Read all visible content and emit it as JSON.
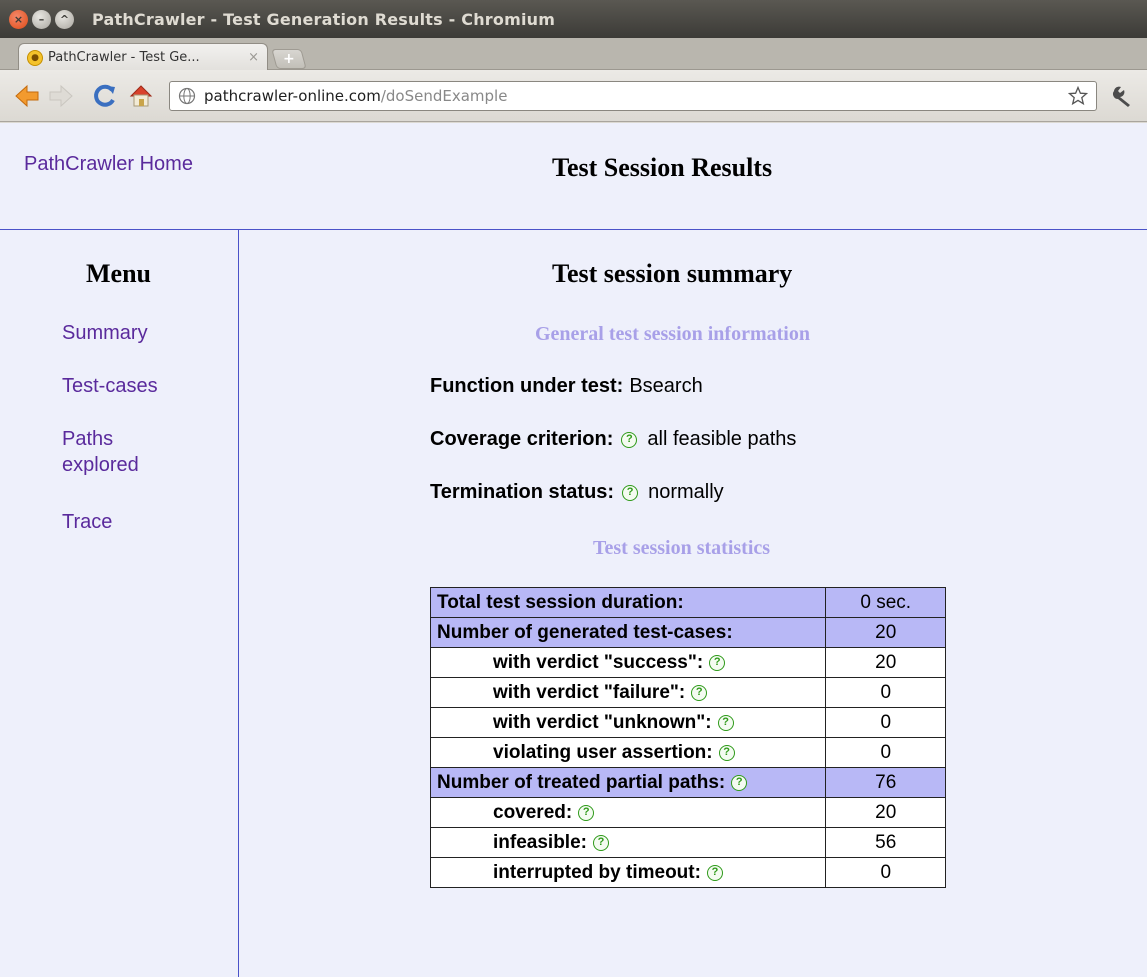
{
  "window": {
    "title": "PathCrawler - Test Generation Results - Chromium"
  },
  "tab": {
    "title": "PathCrawler - Test Ge...",
    "close": "×",
    "new_tab": "+"
  },
  "toolbar": {
    "url_host": "pathcrawler-online.com",
    "url_path": "/doSendExample"
  },
  "header": {
    "home_link": "PathCrawler Home",
    "title": "Test Session Results"
  },
  "menu": {
    "title": "Menu",
    "items": [
      {
        "label": "Summary"
      },
      {
        "label": "Test-cases"
      },
      {
        "label": "Paths explored"
      },
      {
        "label": "Trace"
      }
    ]
  },
  "summary": {
    "title": "Test session summary",
    "general_heading": "General test session information",
    "function_label": "Function under test:",
    "function_value": "Bsearch",
    "coverage_label": "Coverage criterion:",
    "coverage_value": "all feasible paths",
    "termination_label": "Termination status:",
    "termination_value": "normally",
    "stats_heading": "Test session statistics",
    "help_glyph": "?"
  },
  "stats": {
    "rows": [
      {
        "label": "Total test session duration:",
        "value": "0 sec."
      },
      {
        "label": "Number of generated test-cases:",
        "value": "20"
      },
      {
        "label": "with verdict \"success\":",
        "value": "20"
      },
      {
        "label": "with verdict \"failure\":",
        "value": "0"
      },
      {
        "label": "with verdict \"unknown\":",
        "value": "0"
      },
      {
        "label": "violating user assertion:",
        "value": "0"
      },
      {
        "label": "Number of treated partial paths:",
        "value": "76"
      },
      {
        "label": "covered:",
        "value": "20"
      },
      {
        "label": "infeasible:",
        "value": "56"
      },
      {
        "label": "interrupted by timeout:",
        "value": "0"
      }
    ]
  },
  "colors": {
    "link": "#5a2a9c",
    "rule": "#4a52c8",
    "sub_heading": "#a8a0e8",
    "table_highlight": "#b8b8f6",
    "page_bg": "#eef0fb",
    "help_icon": "#2f9a1a"
  }
}
